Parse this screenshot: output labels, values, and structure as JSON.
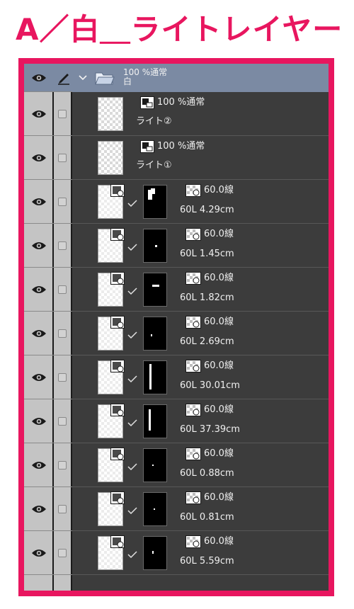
{
  "title": "A／白＿ライトレイヤー",
  "folder": {
    "mode": "100 %通常",
    "name": "白"
  },
  "light_layers": [
    {
      "mode": "100 %通常",
      "name": "ライト②"
    },
    {
      "mode": "100 %通常",
      "name": "ライト①"
    }
  ],
  "vector_layers": [
    {
      "opacity": "60.0線",
      "name": "60L 4.29cm"
    },
    {
      "opacity": "60.0線",
      "name": "60L 1.45cm"
    },
    {
      "opacity": "60.0線",
      "name": "60L 1.82cm"
    },
    {
      "opacity": "60.0線",
      "name": "60L 2.69cm"
    },
    {
      "opacity": "60.0線",
      "name": "60L 30.01cm"
    },
    {
      "opacity": "60.0線",
      "name": "60L 37.39cm"
    },
    {
      "opacity": "60.0線",
      "name": "60L 0.88cm"
    },
    {
      "opacity": "60.0線",
      "name": "60L 0.81cm"
    },
    {
      "opacity": "60.0線",
      "name": "60L 5.59cm"
    }
  ],
  "colors": {
    "accent": "#e8165f",
    "panel": "#3c3c3c",
    "folder_row": "#7b8aa3",
    "column": "#c4c4c4"
  },
  "icons": {
    "visibility": "eye-icon",
    "lock": "checkbox-icon",
    "edit": "pencil-icon",
    "expand": "chevron-down-icon",
    "folder": "folder-icon",
    "raster": "raster-layer-icon",
    "vector": "vector-layer-icon",
    "mask_link": "checkmark-icon"
  }
}
